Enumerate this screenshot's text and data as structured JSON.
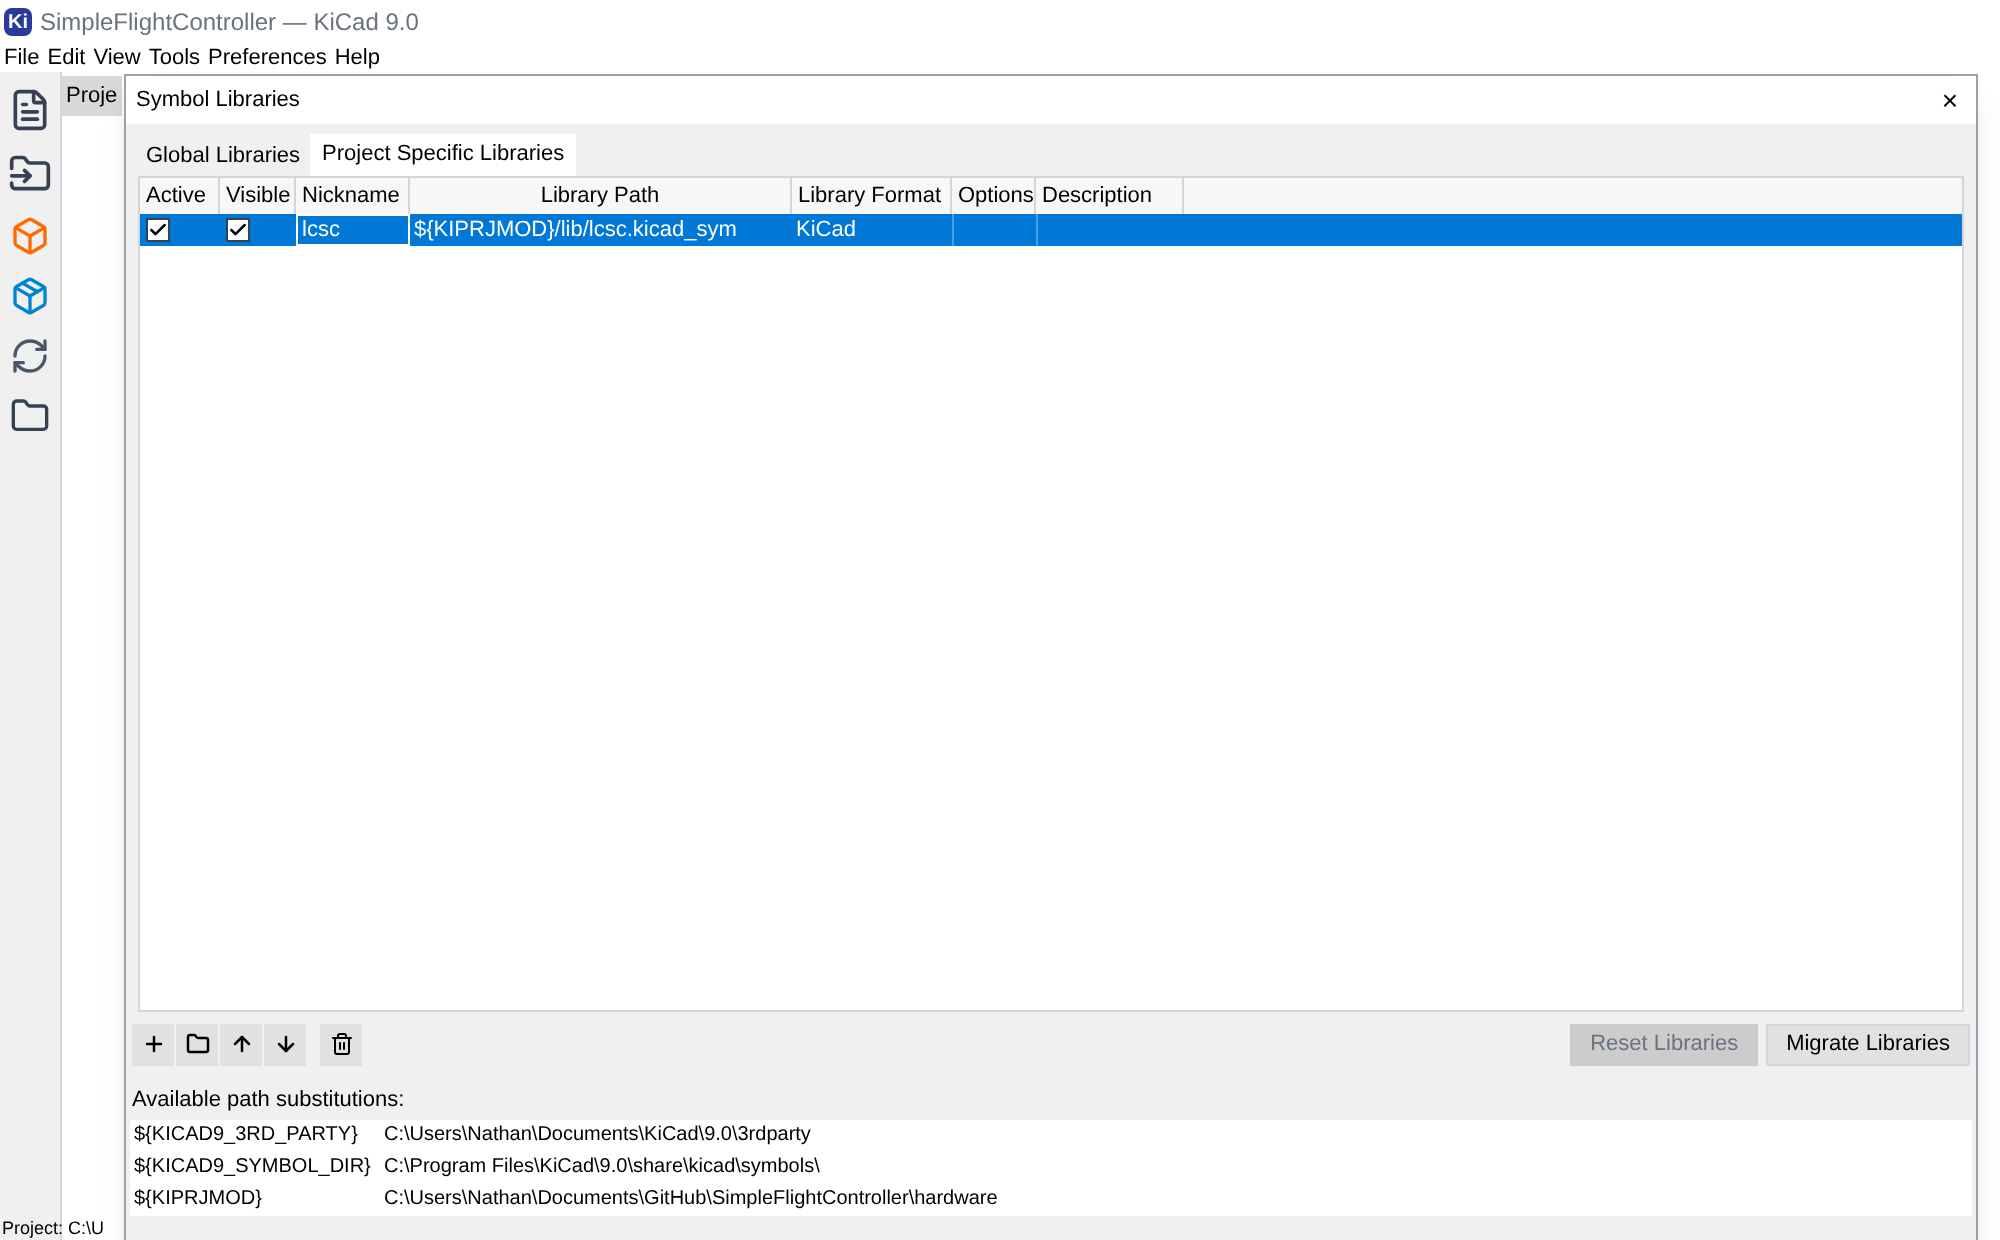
{
  "app": {
    "logo": "Ki",
    "title": "SimpleFlightController — KiCad 9.0",
    "menu": [
      "File",
      "Edit",
      "View",
      "Tools",
      "Preferences",
      "Help"
    ],
    "panel_header": "Proje",
    "status": "Project: C:\\U"
  },
  "dialog": {
    "title": "Symbol Libraries",
    "close": "×",
    "tabs": [
      {
        "label": "Global Libraries",
        "selected": false
      },
      {
        "label": "Project Specific Libraries",
        "selected": true
      }
    ],
    "columns": [
      "Active",
      "Visible",
      "Nickname",
      "Library Path",
      "Library Format",
      "Options",
      "Description"
    ],
    "rows": [
      {
        "active": true,
        "visible": true,
        "nickname": "lcsc",
        "path": "${KIPRJMOD}/lib/lcsc.kicad_sym",
        "format": "KiCad",
        "selected": true
      }
    ],
    "buttons": [
      {
        "label": "Reset Libraries",
        "disabled": true
      },
      {
        "label": "Migrate Libraries",
        "disabled": false
      }
    ],
    "subs_label": "Available path substitutions:",
    "substitutions": [
      {
        "name": "${KICAD9_3RD_PARTY}",
        "path": "C:\\Users\\Nathan\\Documents\\KiCad\\9.0\\3rdparty"
      },
      {
        "name": "${KICAD9_SYMBOL_DIR}",
        "path": "C:\\Program Files\\KiCad\\9.0\\share\\kicad\\symbols\\"
      },
      {
        "name": "${KIPRJMOD}",
        "path": "C:\\Users\\Nathan\\Documents\\GitHub\\SimpleFlightController\\hardware"
      }
    ]
  }
}
